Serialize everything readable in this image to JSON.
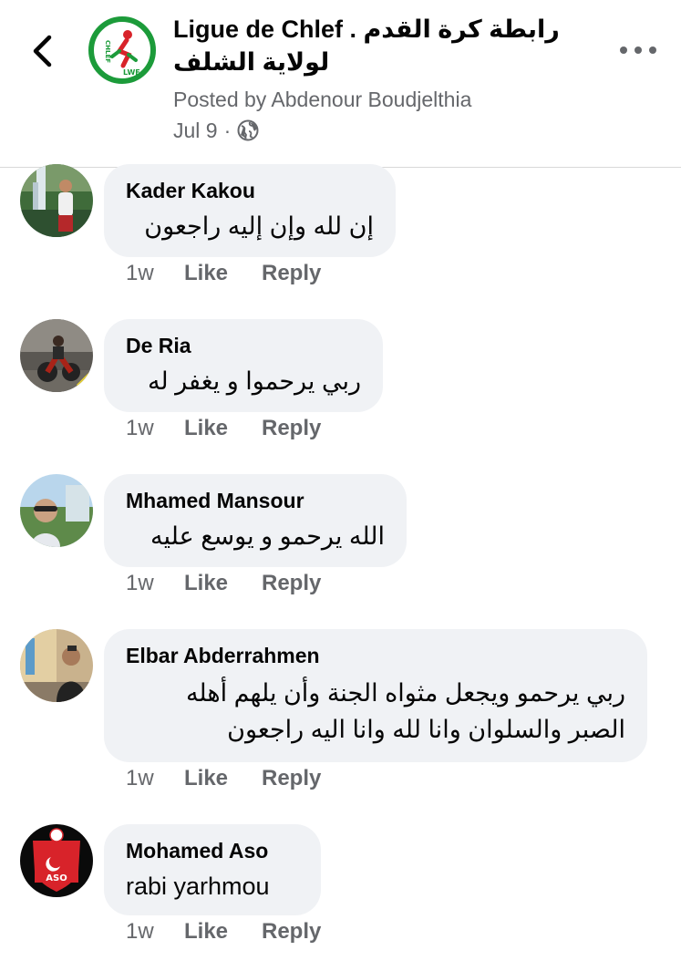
{
  "header": {
    "title": "Ligue de Chlef . رابطة كرة القدم\nلولاية الشلف",
    "posted_by": "Posted by Abdenour Boudjelthia",
    "date": "Jul 9",
    "separator": "·",
    "icons": {
      "back": "chevron-left-icon",
      "privacy": "globe-icon",
      "more": "more-dots-icon"
    },
    "logo_text": {
      "left": "CHLEF",
      "bottom": "LWF"
    },
    "colors": {
      "logo_green": "#1c9b3a",
      "logo_red": "#d8232a"
    }
  },
  "actions": {
    "like_label": "Like",
    "reply_label": "Reply"
  },
  "comments": [
    {
      "name": "Kader Kakou",
      "text": "إن لله وإن إليه راجعون",
      "time": "1w"
    },
    {
      "name": "De Ria",
      "text": "ربي يرحموا و يغفر له",
      "time": "1w"
    },
    {
      "name": "Mhamed Mansour",
      "text": "الله يرحمو و يوسع عليه",
      "time": "1w"
    },
    {
      "name": "Elbar Abderrahmen",
      "text_line1": "ربي يرحمو ويجعل مثواه الجنة وأن يلهم أهله",
      "text_line2": "الصبر والسلوان وانا لله وانا اليه راجعون",
      "time": "1w"
    },
    {
      "name": "Mohamed Aso",
      "text": "rabi yarhmou",
      "time": "1w",
      "avatar_text": "ASO"
    }
  ],
  "colors": {
    "bubble": "#f0f2f5",
    "secondary_text": "#65676b",
    "primary_text": "#050505"
  }
}
